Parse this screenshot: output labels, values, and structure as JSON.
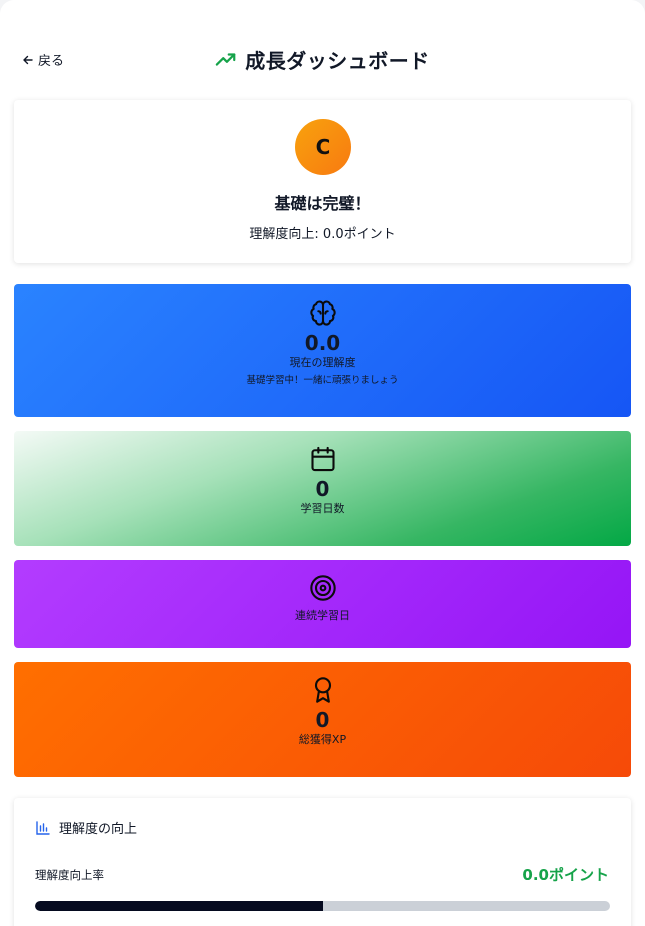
{
  "header": {
    "back_label": "戻る",
    "title": "成長ダッシュボード"
  },
  "grade": {
    "letter": "C",
    "heading": "基礎は完璧！",
    "improvement": "理解度向上: 0.0ポイント",
    "colors": {
      "from": "#f8a20e",
      "to": "#f87a10"
    }
  },
  "stats": {
    "understanding": {
      "icon": "brain-icon",
      "value": "0.0",
      "label": "現在の理解度",
      "note": "基礎学習中！一緒に頑張りましょう",
      "color": "#1e6cff"
    },
    "study_days": {
      "icon": "calendar-icon",
      "value": "0",
      "label": "学習日数",
      "color": "#03a845"
    },
    "streak": {
      "icon": "target-icon",
      "label": "連続学習日",
      "color": "#a020ff"
    },
    "total_xp": {
      "icon": "award-icon",
      "value": "0",
      "label": "総獲得XP",
      "color": "#ff5f05"
    }
  },
  "improvement_section": {
    "icon": "bar-chart-icon",
    "title": "理解度の向上",
    "rate_label": "理解度向上率",
    "rate_value": "0.0ポイント",
    "progress": 0.5,
    "accent": "#16a34a"
  }
}
